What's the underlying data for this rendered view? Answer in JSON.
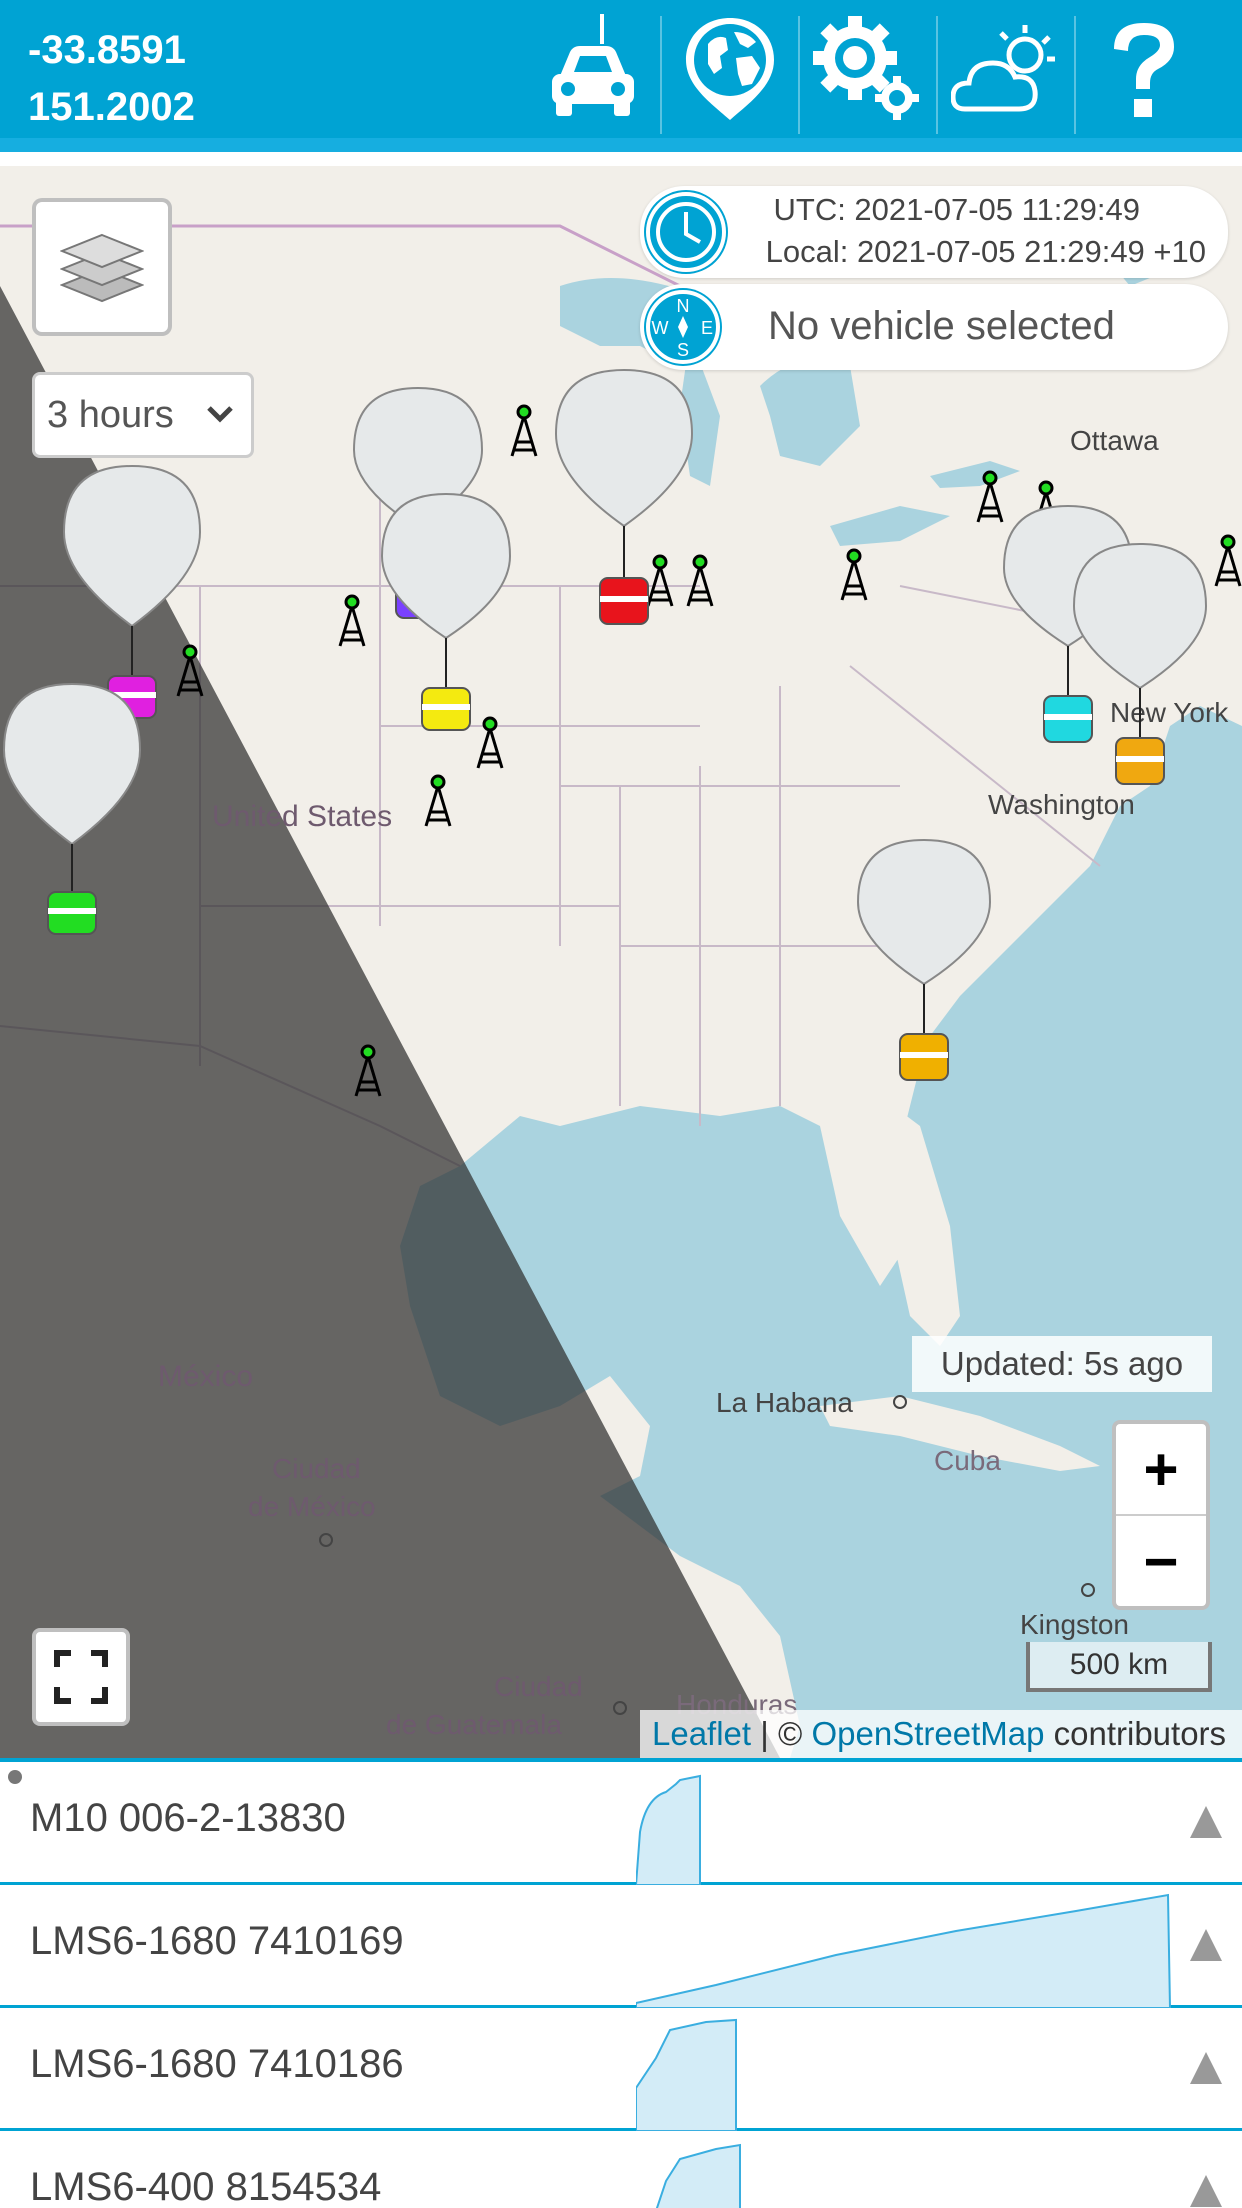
{
  "header": {
    "latitude": "-33.8591",
    "longitude": "151.2002",
    "buttons": [
      {
        "icon": "car-icon"
      },
      {
        "icon": "globe-pin-icon"
      },
      {
        "icon": "gears-icon"
      },
      {
        "icon": "weather-icon"
      },
      {
        "icon": "help-icon"
      }
    ],
    "bg_color": "#00a3d3"
  },
  "map": {
    "time_range": "3 hours",
    "utc_time": "UTC: 2021-07-05 11:29:49",
    "local_time": "Local: 2021-07-05 21:29:49 +10",
    "vehicle_status": "No vehicle selected",
    "updated": "Updated: 5s ago",
    "zoom_in": "+",
    "zoom_out": "−",
    "scale": "500 km",
    "attribution": {
      "leaflet": "Leaflet",
      "sep": " | © ",
      "osm": "OpenStreetMap",
      "contributors": " contributors"
    },
    "labels": {
      "united_states": "United States",
      "mexico": "México",
      "ciudad_mexico_1": "Ciudad",
      "ciudad_mexico_2": "de México",
      "ciudad_guatemala_1": "Ciudad",
      "ciudad_guatemala_2": "de Guatemala",
      "la_habana": "La Habana",
      "cuba": "Cuba",
      "kingston": "Kingston",
      "honduras": "Honduras",
      "ottawa": "Ottawa",
      "new_york": "New York",
      "washington": "Washington"
    },
    "balloon_colors": [
      "#e020e0",
      "#22dd22",
      "#7a40ff",
      "#f4ea10",
      "#e8141c",
      "#20d8e0",
      "#f0a810",
      "#f0b000"
    ]
  },
  "vehicles": [
    {
      "name": "M10 006-2-13830"
    },
    {
      "name": "LMS6-1680 7410169"
    },
    {
      "name": "LMS6-1680 7410186"
    },
    {
      "name": "LMS6-400 8154534"
    }
  ]
}
